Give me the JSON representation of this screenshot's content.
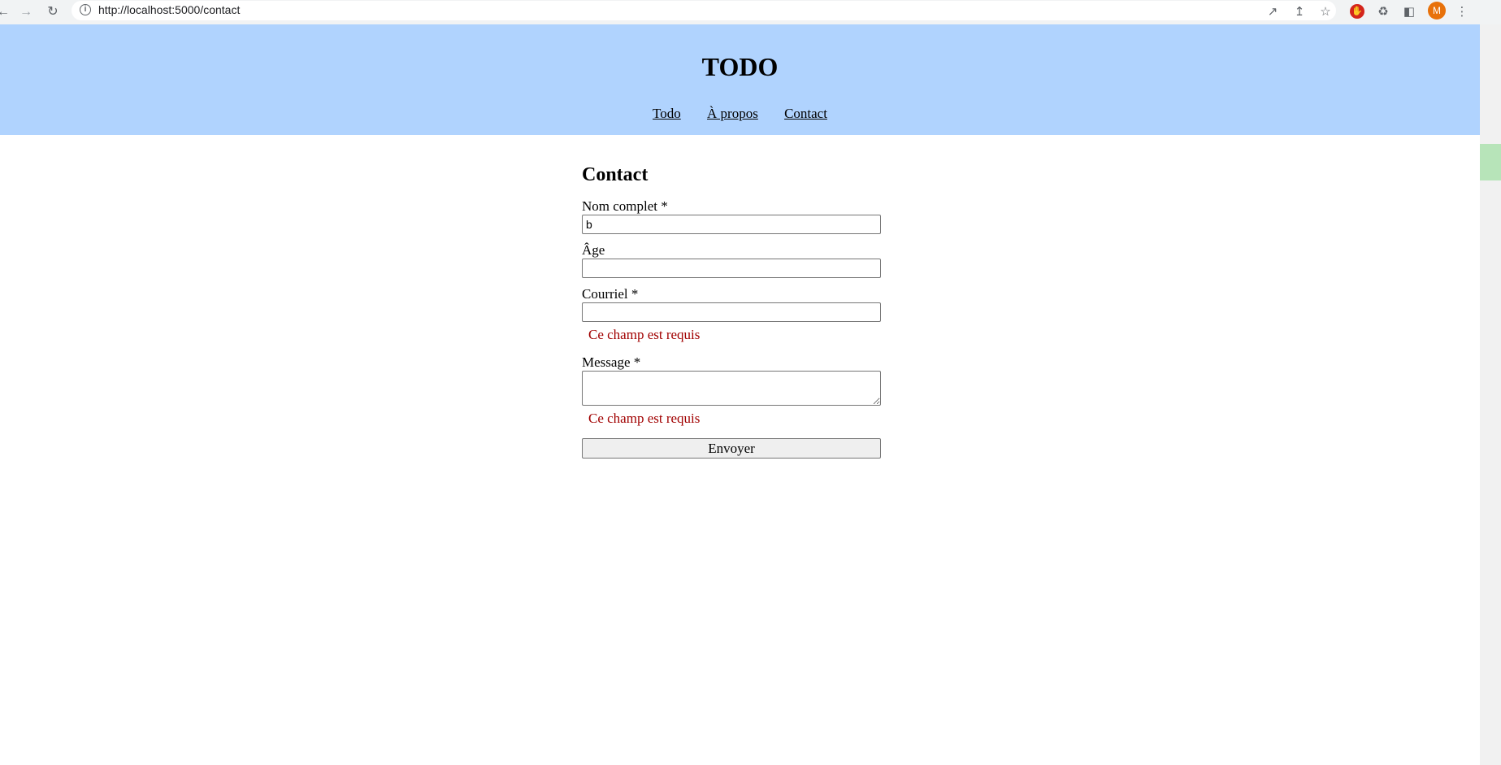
{
  "browser": {
    "url": "http://localhost:5000/contact",
    "back_icon": "arrow-left-icon",
    "forward_icon": "arrow-right-icon",
    "reload_icon": "reload-icon",
    "profile_initial": "M"
  },
  "header": {
    "title": "TODO",
    "nav": [
      "Todo",
      "À propos",
      "Contact"
    ],
    "background": "#b0d3fe"
  },
  "form": {
    "title": "Contact",
    "fields": [
      {
        "label": "Nom complet *",
        "value": "b"
      },
      {
        "label": "Âge",
        "value": ""
      },
      {
        "label": "Courriel *",
        "value": "",
        "error": "Ce champ est requis"
      },
      {
        "label": "Message *",
        "value": "",
        "error": "Ce champ est requis"
      }
    ],
    "submit_label": "Envoyer",
    "error_color": "#a10000"
  }
}
